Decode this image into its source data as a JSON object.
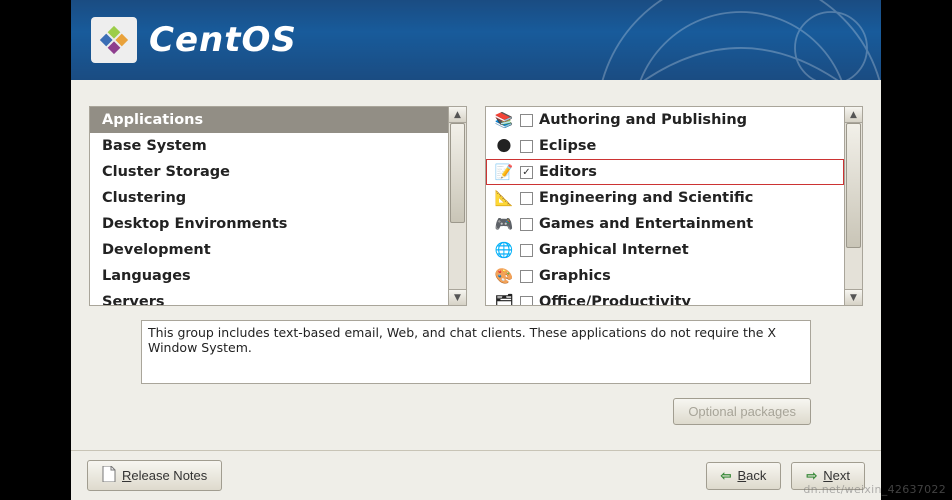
{
  "header": {
    "brand": "CentOS"
  },
  "categories": {
    "items": [
      {
        "label": "Applications",
        "selected": true
      },
      {
        "label": "Base System"
      },
      {
        "label": "Cluster Storage"
      },
      {
        "label": "Clustering"
      },
      {
        "label": "Desktop Environments"
      },
      {
        "label": "Development"
      },
      {
        "label": "Languages"
      },
      {
        "label": "Servers"
      }
    ]
  },
  "packages": {
    "items": [
      {
        "icon": "📚",
        "checked": false,
        "label": "Authoring and Publishing"
      },
      {
        "icon": "🌑",
        "checked": false,
        "label": "Eclipse"
      },
      {
        "icon": "📝",
        "checked": true,
        "label": "Editors",
        "highlighted": true
      },
      {
        "icon": "📐",
        "checked": false,
        "label": "Engineering and Scientific"
      },
      {
        "icon": "🎮",
        "checked": false,
        "label": "Games and Entertainment"
      },
      {
        "icon": "🌐",
        "checked": false,
        "label": "Graphical Internet"
      },
      {
        "icon": "🎨",
        "checked": false,
        "label": "Graphics"
      },
      {
        "icon": "🗂",
        "checked": false,
        "label": "Office/Productivity"
      }
    ]
  },
  "description": "This group includes text-based email, Web, and chat clients. These applications do not require the X Window System.",
  "buttons": {
    "optional": "Optional packages",
    "release_notes": "Release Notes",
    "back": "Back",
    "next": "Next"
  },
  "watermark": "dn.net/weixin_42637022"
}
